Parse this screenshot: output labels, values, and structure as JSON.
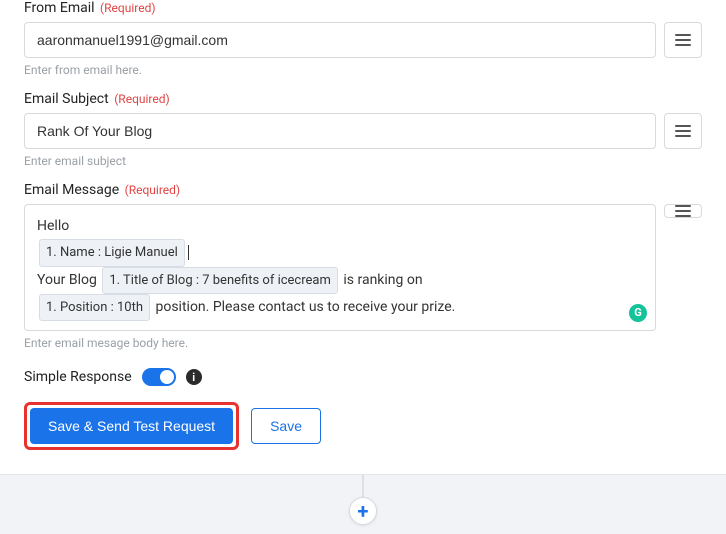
{
  "fields": {
    "fromEmail": {
      "label": "From Email",
      "required": "(Required)",
      "value": "aaronmanuel1991@gmail.com",
      "helper": "Enter from email here."
    },
    "subject": {
      "label": "Email Subject",
      "required": "(Required)",
      "value": "Rank Of Your Blog",
      "helper": "Enter email subject"
    },
    "message": {
      "label": "Email Message",
      "required": "(Required)",
      "textHello": "Hello",
      "tokenName": "1. Name : Ligie Manuel",
      "textYourBlog": "Your Blog",
      "tokenTitle": "1. Title of Blog : 7 benefits of icecream",
      "textRanking": "is ranking on",
      "tokenPosition": "1. Position : 10th",
      "textContact": "position. Please contact us to receive your prize.",
      "helper": "Enter email mesage body here.",
      "badge": "G"
    }
  },
  "toggle": {
    "label": "Simple Response",
    "info": "i"
  },
  "buttons": {
    "primary": "Save & Send Test Request",
    "secondary": "Save"
  },
  "plus": "+"
}
